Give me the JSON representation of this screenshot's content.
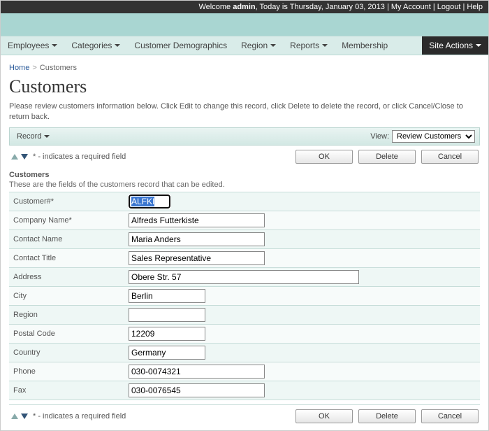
{
  "topbar": {
    "welcome_prefix": "Welcome ",
    "user": "admin",
    "date_prefix": ", Today is ",
    "date": "Thursday, January 03, 2013",
    "my_account": "My Account",
    "logout": "Logout",
    "help": "Help"
  },
  "menu": {
    "employees": "Employees",
    "categories": "Categories",
    "demographics": "Customer Demographics",
    "region": "Region",
    "reports": "Reports",
    "membership": "Membership",
    "site_actions": "Site Actions"
  },
  "breadcrumb": {
    "home": "Home",
    "current": "Customers"
  },
  "page_title": "Customers",
  "instructions": "Please review customers information below. Click Edit to change this record, click Delete to delete the record, or click Cancel/Close to return back.",
  "toolbar": {
    "record": "Record",
    "view_label": "View:",
    "view_options": [
      "Review Customers"
    ],
    "view_selected": "Review Customers"
  },
  "required_note": "* - indicates a required field",
  "buttons": {
    "ok": "OK",
    "delete": "Delete",
    "cancel": "Cancel"
  },
  "section": {
    "title": "Customers",
    "desc": "These are the fields of the customers record that can be edited."
  },
  "fields": {
    "customer_id": {
      "label": "Customer#*",
      "value": "ALFKI"
    },
    "company": {
      "label": "Company Name*",
      "value": "Alfreds Futterkiste"
    },
    "contact_name": {
      "label": "Contact Name",
      "value": "Maria Anders"
    },
    "contact_title": {
      "label": "Contact Title",
      "value": "Sales Representative"
    },
    "address": {
      "label": "Address",
      "value": "Obere Str. 57"
    },
    "city": {
      "label": "City",
      "value": "Berlin"
    },
    "region": {
      "label": "Region",
      "value": ""
    },
    "postal": {
      "label": "Postal Code",
      "value": "12209"
    },
    "country": {
      "label": "Country",
      "value": "Germany"
    },
    "phone": {
      "label": "Phone",
      "value": "030-0074321"
    },
    "fax": {
      "label": "Fax",
      "value": "030-0076545"
    }
  }
}
